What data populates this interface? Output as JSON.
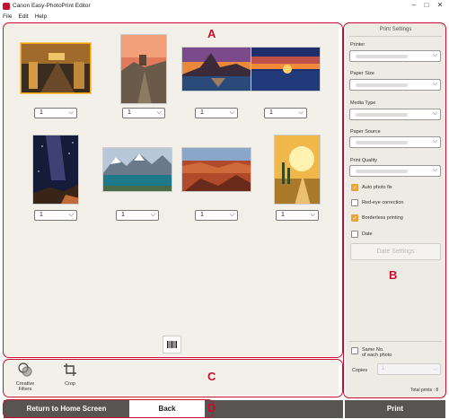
{
  "window": {
    "title": "Canon Easy-PhotoPrint Editor",
    "controls": [
      "–",
      "□",
      "✕"
    ]
  },
  "menu": [
    "File",
    "Edit",
    "Help"
  ],
  "photos": [
    {
      "name": "photo-railway-station",
      "copies": "1"
    },
    {
      "name": "photo-cliff-fortress",
      "copies": "1"
    },
    {
      "name": "photo-mountain-lake",
      "copies": "1"
    },
    {
      "name": "photo-sunset-sea",
      "copies": "1"
    },
    {
      "name": "photo-milky-way",
      "copies": "1"
    },
    {
      "name": "photo-alpine-lake",
      "copies": "1"
    },
    {
      "name": "photo-canyon",
      "copies": "1"
    },
    {
      "name": "photo-sunlit-path",
      "copies": "1"
    }
  ],
  "tools": {
    "creative_filters": "Creative\nFilters",
    "crop": "Crop"
  },
  "print_settings": {
    "title": "Print Settings",
    "printer": "Printer",
    "paper_size": "Paper Size",
    "media_type": "Media Type",
    "paper_source": "Paper Source",
    "print_quality": "Print Quality",
    "auto_photo_fix": "Auto photo fix",
    "red_eye": "Red-eye correction",
    "borderless": "Borderless printing",
    "date": "Date",
    "date_settings": "Date Settings",
    "same_no": "Same No.\nof each photo",
    "copies_label": "Copies",
    "copies_value": "1",
    "total_prints": "Total prints : 8"
  },
  "bottom": {
    "return_home": "Return to Home Screen",
    "back": "Back",
    "print": "Print"
  },
  "callouts": {
    "a": "A",
    "b": "B",
    "c": "C",
    "d": "D"
  },
  "colors": {
    "accent": "#c8102e",
    "check": "#e8a33a",
    "dark_button": "#585452"
  }
}
